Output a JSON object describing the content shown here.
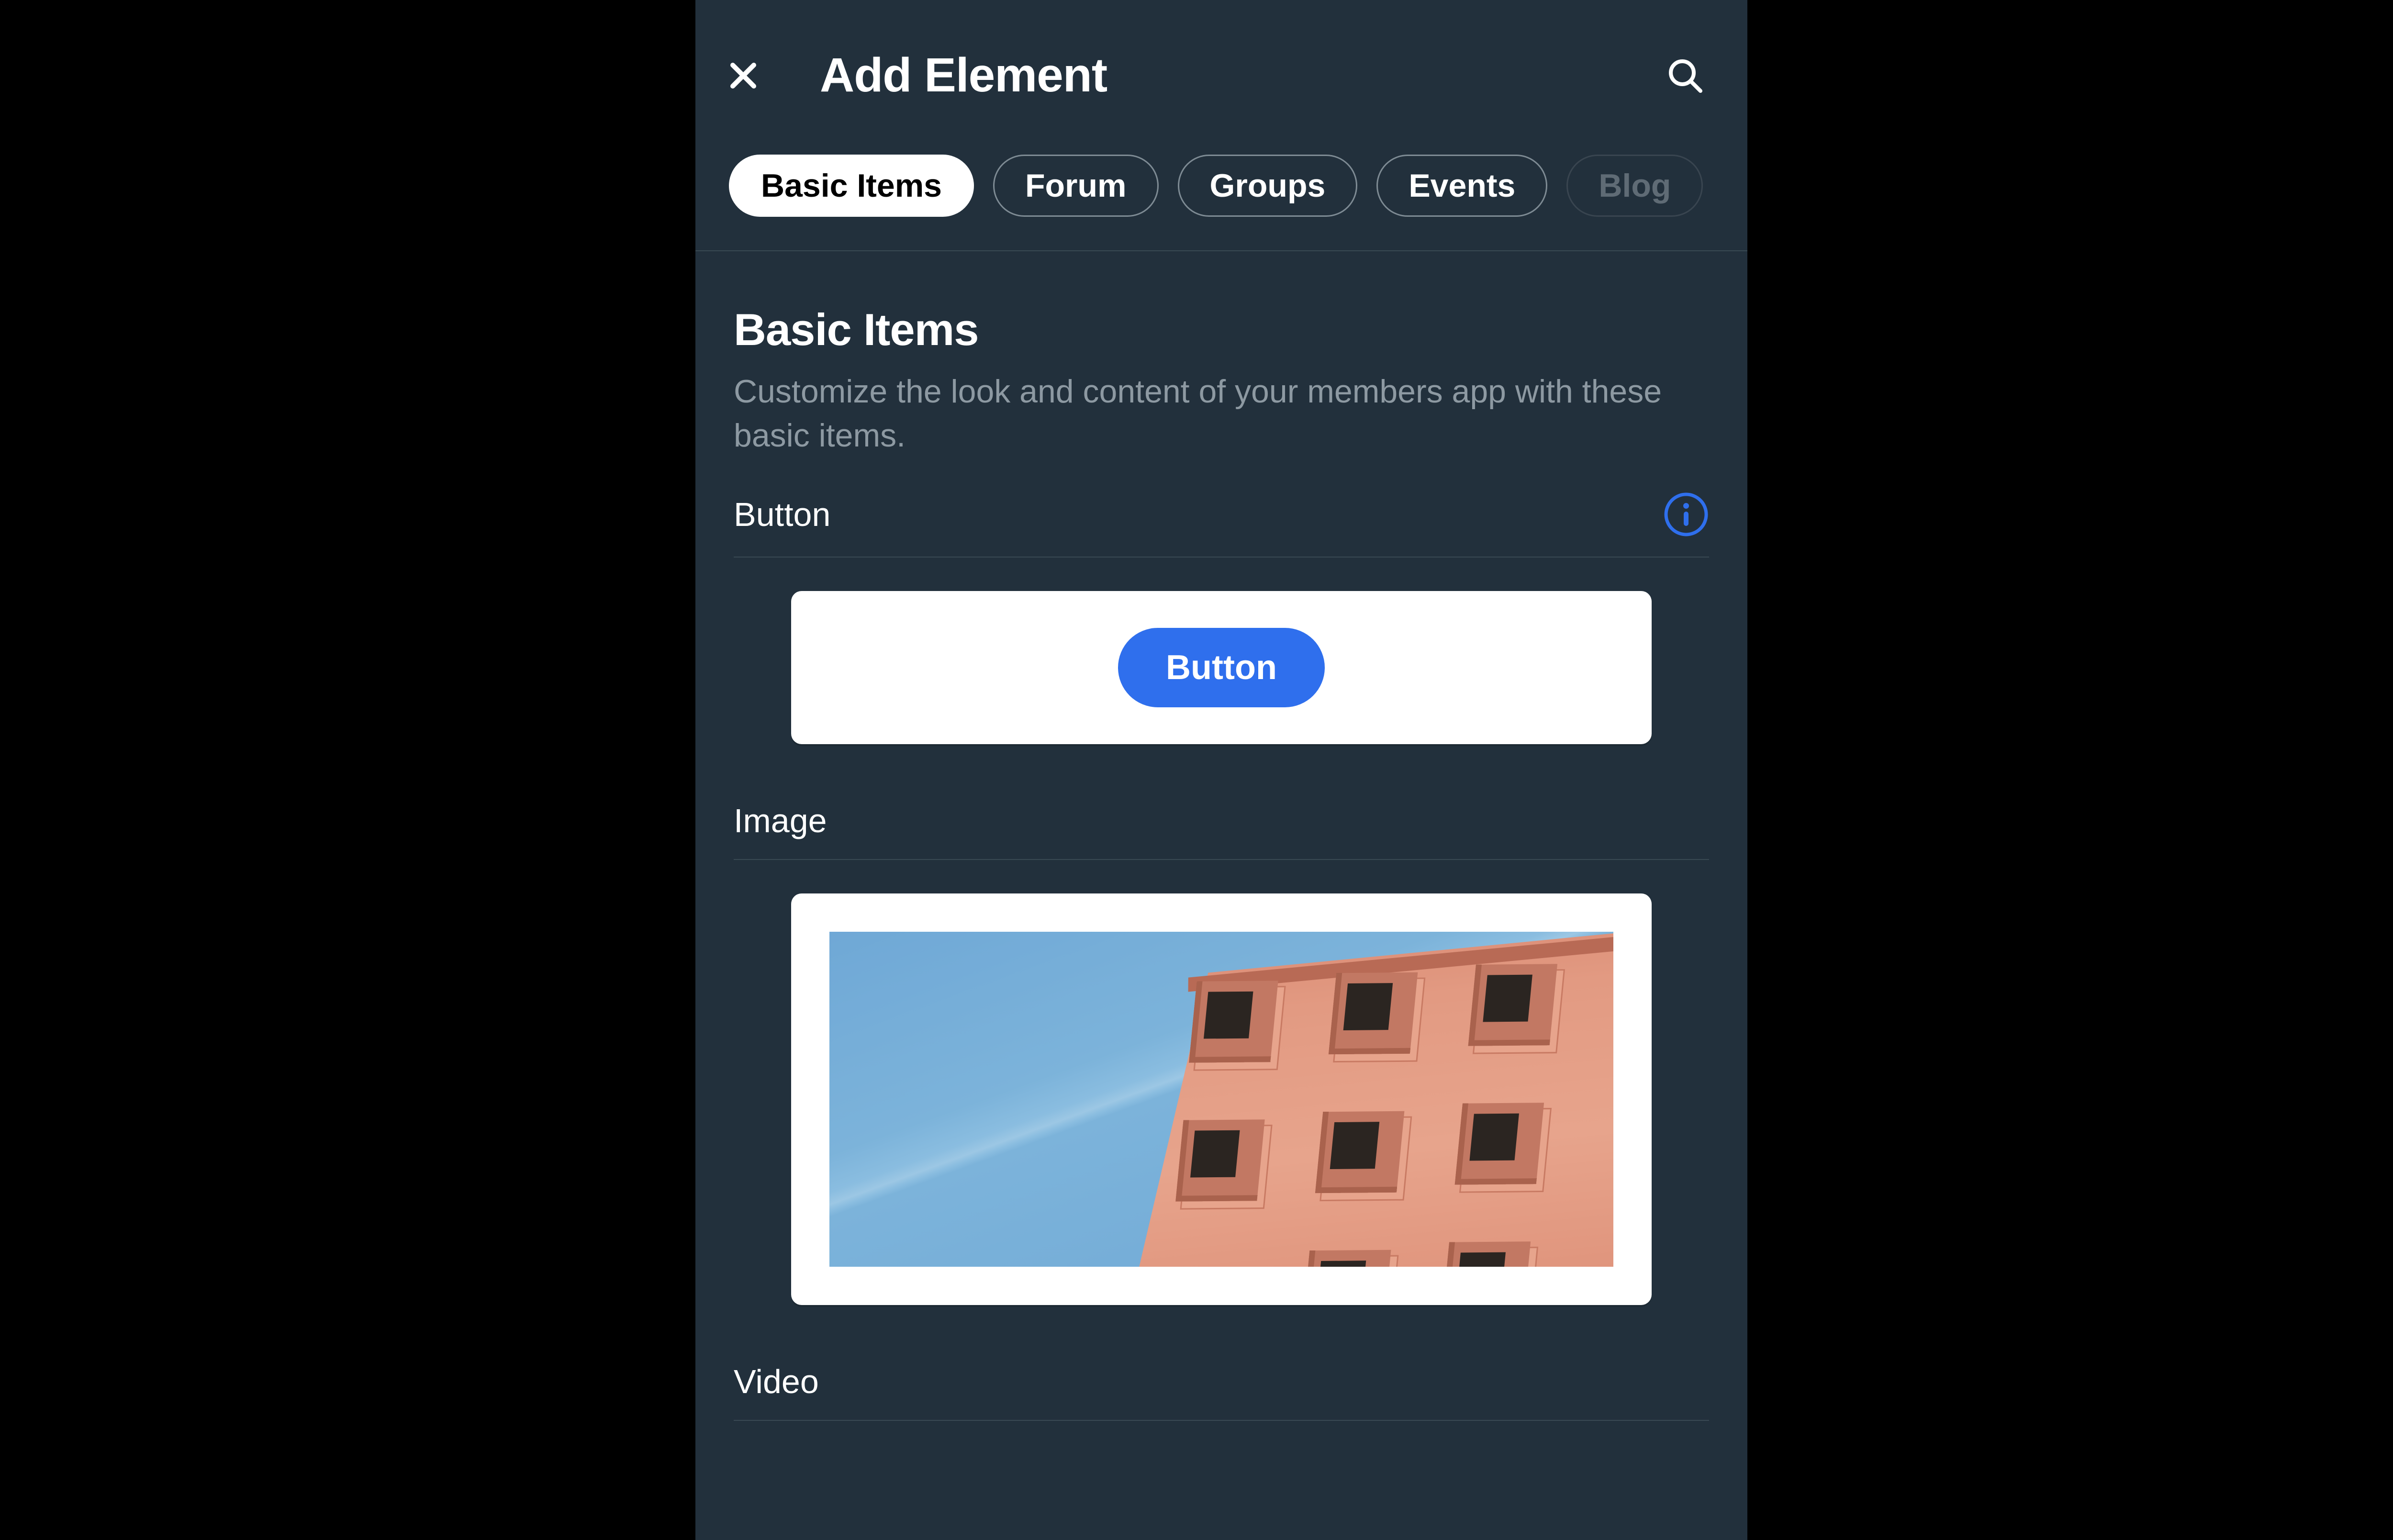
{
  "header": {
    "title": "Add Element"
  },
  "tabs": [
    {
      "label": "Basic Items",
      "active": true
    },
    {
      "label": "Forum",
      "active": false
    },
    {
      "label": "Groups",
      "active": false
    },
    {
      "label": "Events",
      "active": false
    },
    {
      "label": "Blog",
      "active": false,
      "faded": true
    }
  ],
  "section": {
    "heading": "Basic Items",
    "description": "Customize the look and content of your members app with these basic items."
  },
  "items": {
    "button": {
      "label": "Button",
      "preview_button_label": "Button"
    },
    "image": {
      "label": "Image"
    },
    "video": {
      "label": "Video"
    }
  },
  "colors": {
    "accent": "#2f6fed",
    "panel_bg": "#22303c",
    "muted_text": "#8d99a2",
    "info_icon": "#2f6fed"
  }
}
